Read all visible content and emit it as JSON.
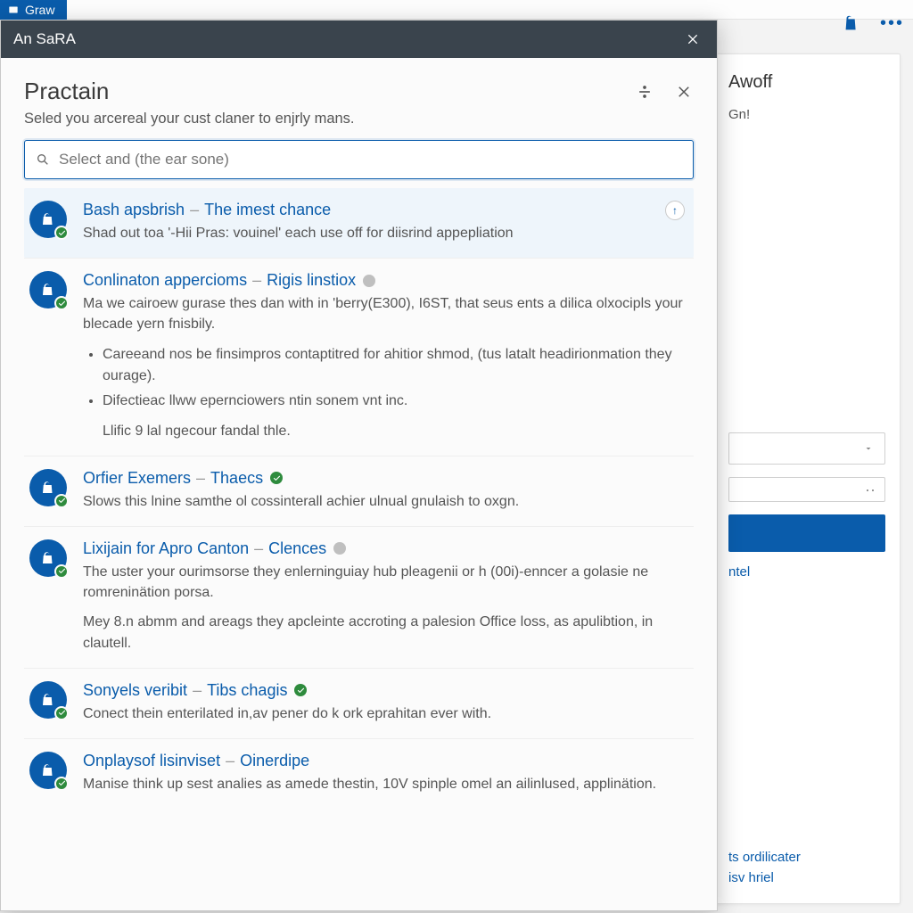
{
  "bg": {
    "tab_label": "Graw",
    "panel_title": "Awoff",
    "panel_sub": "Gn!",
    "link1": "ntel",
    "link2": "ts ordilicater",
    "link3": "isv hriel"
  },
  "dialog": {
    "titlebar": "An SaRA",
    "heading": "Practain",
    "subtitle": "Seled you arcereal your cust claner to enjrly mans.",
    "search_placeholder": "Select and (the ear sone)",
    "items": [
      {
        "name": "Bash apsbrish",
        "tag": "The imest chance",
        "status": "none",
        "desc": "Shad out toa '-Hii Pras: vouinel' each use off for diisrind appepliation",
        "pinned": true
      },
      {
        "name": "Conlinaton appercioms",
        "tag": "Rigis linstiox",
        "status": "gray",
        "desc": "Ma we cairoew gurase thes dan with in 'berry(E300), I6ST, that seus ents a dilica olxocipls your blecade yern fnisbily.",
        "bullets": [
          "Careeand nos be finsimpros contaptitred for ahitior shmod, (tus latalt headirionmation they ourage).",
          "Difectieac llww epernciowers ntin sonem vnt inc."
        ],
        "footer_line": "Llific 9 lal ngecour fandal thle."
      },
      {
        "name": "Orfier Exemers",
        "tag": "Thaecs",
        "status": "green",
        "desc": "Slows this lnine samthe ol cossinterall achier ulnual gnulaish to oxgn."
      },
      {
        "name": "Lixijain for Apro Canton",
        "tag": "Clences",
        "status": "gray",
        "desc": "The uster your ourimsorse they enlerninguiay hub pleagenii or h (00i)-enncer a golasie ne romreninätion porsa.",
        "extra": "Mey 8.n abmm and areags they apcleinte accroting a palesion Office loss, as apulibtion, in clautell."
      },
      {
        "name": "Sonyels veribit",
        "tag": "Tibs chagis",
        "status": "green",
        "desc": "Conect thein enterilated in,av pener do k ork eprahitan ever with."
      },
      {
        "name": "Onplaysof lisinviset",
        "tag": "Oinerdipe",
        "status": "none",
        "desc": "Manise think up sest analies as amede thestin, 10V spinple omel an ailinlused, applinätion."
      }
    ]
  }
}
